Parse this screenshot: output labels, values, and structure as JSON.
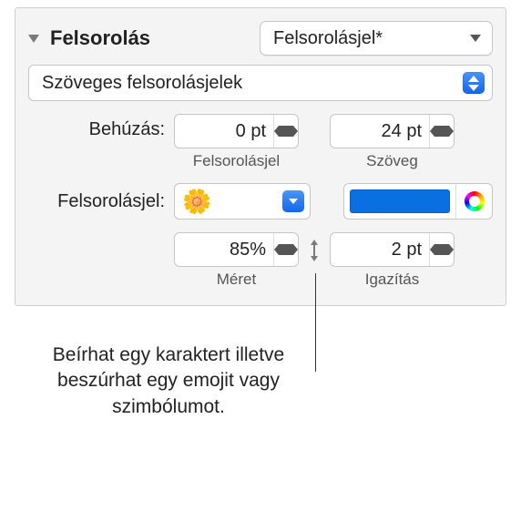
{
  "header": {
    "label": "Felsorolás",
    "style_popup": "Felsorolásjel*"
  },
  "type_popup": "Szöveges felsorolásjelek",
  "indent": {
    "label": "Behúzás:",
    "bullet_value": "0 pt",
    "bullet_sublabel": "Felsorolásjel",
    "text_value": "24 pt",
    "text_sublabel": "Szöveg"
  },
  "bullet": {
    "label": "Felsorolásjel:",
    "glyph": "🌼",
    "color": "#0a6fe0"
  },
  "size": {
    "value": "85%",
    "sublabel": "Méret"
  },
  "align": {
    "value": "2 pt",
    "sublabel": "Igazítás"
  },
  "callout": "Beírhat egy karaktert illetve beszúrhat egy emojit vagy szimbólumot."
}
